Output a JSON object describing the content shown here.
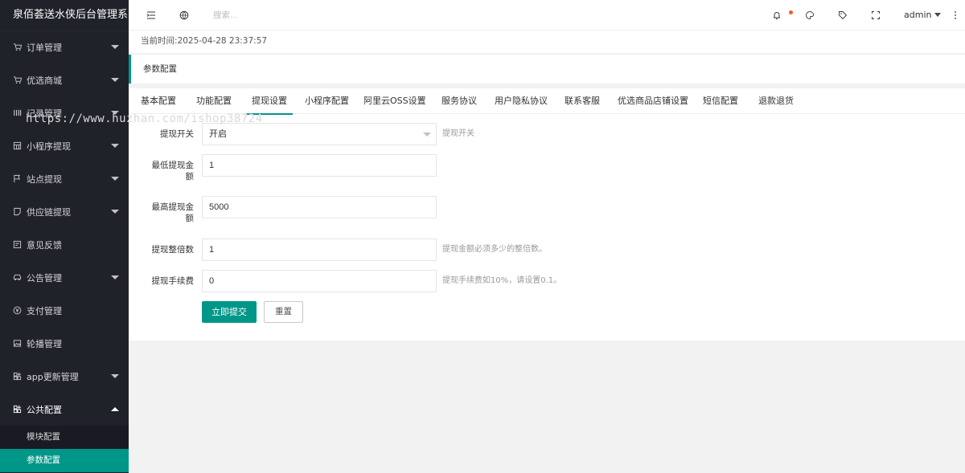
{
  "app": {
    "title": "泉佰荟送水侠后台管理系"
  },
  "sidebar": {
    "items": [
      {
        "label": "订单管理",
        "icon": "cart-icon"
      },
      {
        "label": "优选商城",
        "icon": "cart-icon"
      },
      {
        "label": "记录管理",
        "icon": "list-icon"
      },
      {
        "label": "小程序提现",
        "icon": "grid-icon"
      },
      {
        "label": "站点提现",
        "icon": "flag-icon"
      },
      {
        "label": "供应链提现",
        "icon": "note-icon"
      },
      {
        "label": "意见反馈",
        "icon": "feedback-icon"
      },
      {
        "label": "公告管理",
        "icon": "car-icon"
      },
      {
        "label": "支付管理",
        "icon": "yen-icon"
      },
      {
        "label": "轮播管理",
        "icon": "picture-icon"
      },
      {
        "label": "app更新管理",
        "icon": "app-icon"
      },
      {
        "label": "公共配置",
        "icon": "app-icon"
      }
    ],
    "submenu": [
      {
        "label": "模块配置"
      },
      {
        "label": "参数配置"
      }
    ]
  },
  "header": {
    "search_placeholder": "搜索...",
    "user": "admin"
  },
  "timebar": {
    "text": "当前时间:2025-04-28 23:37:57"
  },
  "page": {
    "title": "参数配置"
  },
  "tabs": [
    {
      "label": "基本配置"
    },
    {
      "label": "功能配置"
    },
    {
      "label": "提现设置"
    },
    {
      "label": "小程序配置"
    },
    {
      "label": "阿里云OSS设置"
    },
    {
      "label": "服务协议"
    },
    {
      "label": "用户隐私协议"
    },
    {
      "label": "联系客服"
    },
    {
      "label": "优选商品店铺设置"
    },
    {
      "label": "短信配置"
    },
    {
      "label": "退款退货"
    }
  ],
  "form": {
    "switch": {
      "label": "提现开关",
      "value": "开启",
      "tip": "提现开关"
    },
    "min": {
      "label": "最低提现金额",
      "value": "1"
    },
    "max": {
      "label": "最高提现金额",
      "value": "5000"
    },
    "multiple": {
      "label": "提现整倍数",
      "value": "1",
      "tip": "提现金额必须多少的整倍数。"
    },
    "fee": {
      "label": "提现手续费",
      "value": "0",
      "tip": "提现手续费如10%，请设置0.1。"
    },
    "submit_label": "立即提交",
    "reset_label": "重置"
  },
  "watermark": "https://www.huzhan.com/ishop38724",
  "colors": {
    "accent": "#009688",
    "sidebar_bg": "#20222a",
    "badge": "#ff5722"
  }
}
